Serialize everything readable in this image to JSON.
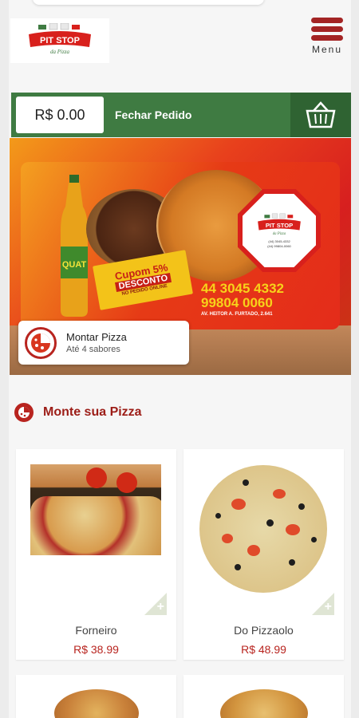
{
  "brand": {
    "logo_text": "PIT STOP",
    "logo_sub": "da Pizza"
  },
  "header": {
    "menu_label": "Menu"
  },
  "order_bar": {
    "total": "R$ 0.00",
    "close_label": "Fechar Pedido"
  },
  "banner": {
    "coupon_line1": "Cupom 5%",
    "coupon_line2": "DESCONTO",
    "coupon_line3": "NO PEDIDO ONLINE",
    "phone1": "44 3045 4332",
    "phone2": "99804 0060",
    "address": "AV. HEITOR A. FURTADO, 2.641",
    "octagon_phone1": "(44) 3045-4332",
    "octagon_phone2": "(44) 99804-0060",
    "bottle_label": "QUAT"
  },
  "build_pizza": {
    "title": "Montar Pizza",
    "subtitle": "Até 4 sabores"
  },
  "section": {
    "title": "Monte sua Pizza"
  },
  "products": [
    {
      "name": "Forneiro",
      "price": "R$ 38.99"
    },
    {
      "name": "Do Pizzaolo",
      "price": "R$ 48.99"
    }
  ],
  "colors": {
    "accent_red": "#b8241f",
    "order_green": "#3f7b42",
    "price_red": "#b8241f"
  }
}
